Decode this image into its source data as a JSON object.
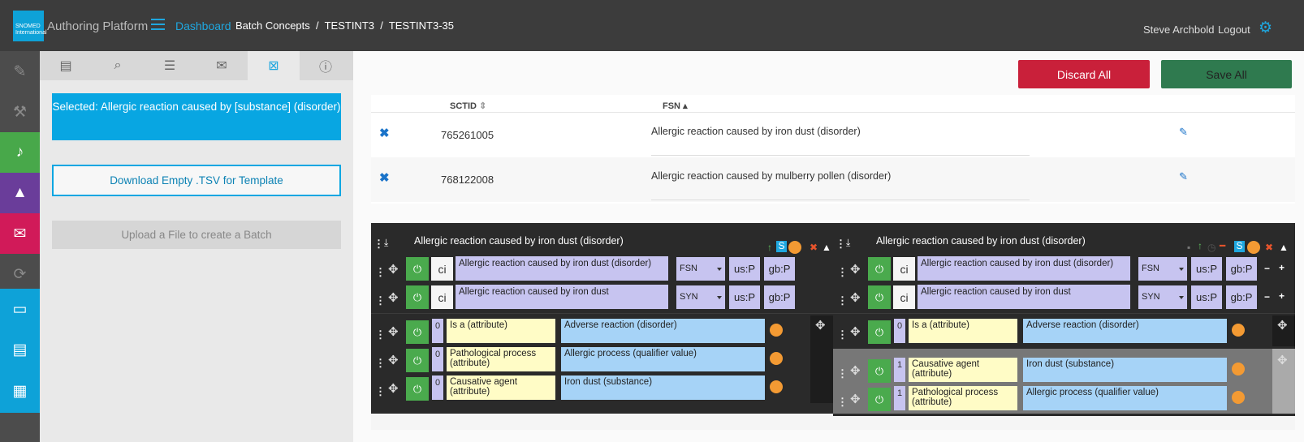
{
  "header": {
    "logo_text": "SNOMED International",
    "app_title": "Authoring Platform",
    "dashboard": "Dashboard",
    "breadcrumb": "Batch Concepts  /  TESTINT3  /  TESTINT3-35",
    "user": "Steve Archbold",
    "logout": "Logout"
  },
  "sidebar": {
    "selected": "Selected: Allergic reaction caused by [substance] (disorder)",
    "download": "Download Empty .TSV for Template",
    "upload": "Upload a File to create a Batch"
  },
  "actions": {
    "discard": "Discard All",
    "save": "Save All"
  },
  "table": {
    "col_sctid": "SCTID",
    "col_fsn": "FSN",
    "rows": [
      {
        "sctid": "765261005",
        "fsn": "Allergic reaction caused by iron dust (disorder)"
      },
      {
        "sctid": "768122008",
        "fsn": "Allergic reaction caused by mulberry pollen (disorder)"
      }
    ]
  },
  "panels": [
    {
      "title": "Allergic reaction caused by iron dust (disorder)",
      "descriptions": [
        {
          "ci": "ci",
          "term": "Allergic reaction caused by iron dust (disorder)",
          "type": "FSN",
          "us": "us:P",
          "gb": "gb:P"
        },
        {
          "ci": "ci",
          "term": "Allergic reaction caused by iron dust",
          "type": "SYN",
          "us": "us:P",
          "gb": "gb:P"
        }
      ],
      "relationships": [
        {
          "group": "0",
          "attr": "Is a (attribute)",
          "value": "Adverse reaction (disorder)"
        },
        {
          "group": "0",
          "attr": "Pathological process (attribute)",
          "value": "Allergic process (qualifier value)"
        },
        {
          "group": "0",
          "attr": "Causative agent (attribute)",
          "value": "Iron dust (substance)"
        }
      ]
    },
    {
      "title": "Allergic reaction caused by iron dust (disorder)",
      "descriptions": [
        {
          "ci": "ci",
          "term": "Allergic reaction caused by iron dust (disorder)",
          "type": "FSN",
          "us": "us:P",
          "gb": "gb:P"
        },
        {
          "ci": "ci",
          "term": "Allergic reaction caused by iron dust",
          "type": "SYN",
          "us": "us:P",
          "gb": "gb:P"
        }
      ],
      "relationships": [
        {
          "group": "0",
          "attr": "Is a (attribute)",
          "value": "Adverse reaction (disorder)"
        },
        {
          "group": "1",
          "attr": "Causative agent (attribute)",
          "value": "Iron dust (substance)"
        },
        {
          "group": "1",
          "attr": "Pathological process (attribute)",
          "value": "Allergic process (qualifier value)"
        }
      ]
    }
  ],
  "colors": {
    "accent": "#1fa7df",
    "discard": "#c9203a",
    "save": "#2f7a4f",
    "power": "#4aaa4d"
  }
}
